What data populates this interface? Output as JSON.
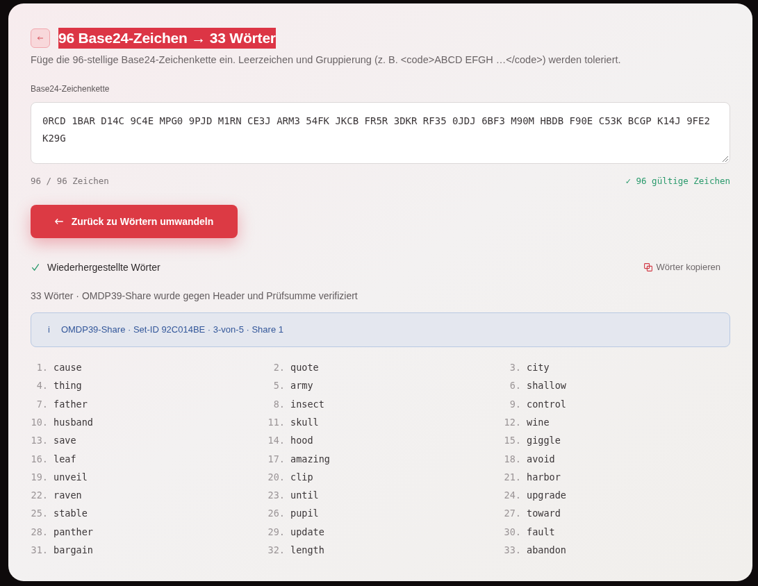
{
  "title": "96 Base24-Zeichen → 33 Wörter",
  "description": "Füge die 96-stellige Base24-Zeichenkette ein. Leerzeichen und Gruppierung (z. B. <code>ABCD EFGH …</code>) werden toleriert.",
  "input": {
    "label": "Base24-Zeichenkette",
    "value": "0RCD 1BAR D14C 9C4E MPG0 9PJD M1RN CE3J ARM3 54FK JKCB FR5R 3DKR RF35 0JDJ 6BF3 M90M HBDB F90E C53K BCGP K14J 9FE2 K29G",
    "char_count": "96 / 96 Zeichen",
    "valid": true,
    "validation": "✓ 96 gültige Zeichen"
  },
  "convert_button": "Zurück zu Wörtern umwandeln",
  "result": {
    "heading": "Wiederhergestellte Wörter",
    "copy_button": "Wörter kopieren",
    "summary": "33 Wörter · OMDP39-Share wurde gegen Header und Prüfsumme verifiziert",
    "info": {
      "icon_text": "i",
      "text": "OMDP39-Share · Set-ID 92C014BE · 3-von-5 · Share 1"
    },
    "words": [
      {
        "number": "1.",
        "word": "cause"
      },
      {
        "number": "2.",
        "word": "quote"
      },
      {
        "number": "3.",
        "word": "city"
      },
      {
        "number": "4.",
        "word": "thing"
      },
      {
        "number": "5.",
        "word": "army"
      },
      {
        "number": "6.",
        "word": "shallow"
      },
      {
        "number": "7.",
        "word": "father"
      },
      {
        "number": "8.",
        "word": "insect"
      },
      {
        "number": "9.",
        "word": "control"
      },
      {
        "number": "10.",
        "word": "husband"
      },
      {
        "number": "11.",
        "word": "skull"
      },
      {
        "number": "12.",
        "word": "wine"
      },
      {
        "number": "13.",
        "word": "save"
      },
      {
        "number": "14.",
        "word": "hood"
      },
      {
        "number": "15.",
        "word": "giggle"
      },
      {
        "number": "16.",
        "word": "leaf"
      },
      {
        "number": "17.",
        "word": "amazing"
      },
      {
        "number": "18.",
        "word": "avoid"
      },
      {
        "number": "19.",
        "word": "unveil"
      },
      {
        "number": "20.",
        "word": "clip"
      },
      {
        "number": "21.",
        "word": "harbor"
      },
      {
        "number": "22.",
        "word": "raven"
      },
      {
        "number": "23.",
        "word": "until"
      },
      {
        "number": "24.",
        "word": "upgrade"
      },
      {
        "number": "25.",
        "word": "stable"
      },
      {
        "number": "26.",
        "word": "pupil"
      },
      {
        "number": "27.",
        "word": "toward"
      },
      {
        "number": "28.",
        "word": "panther"
      },
      {
        "number": "29.",
        "word": "update"
      },
      {
        "number": "30.",
        "word": "fault"
      },
      {
        "number": "31.",
        "word": "bargain"
      },
      {
        "number": "32.",
        "word": "length"
      },
      {
        "number": "33.",
        "word": "abandon"
      }
    ]
  }
}
